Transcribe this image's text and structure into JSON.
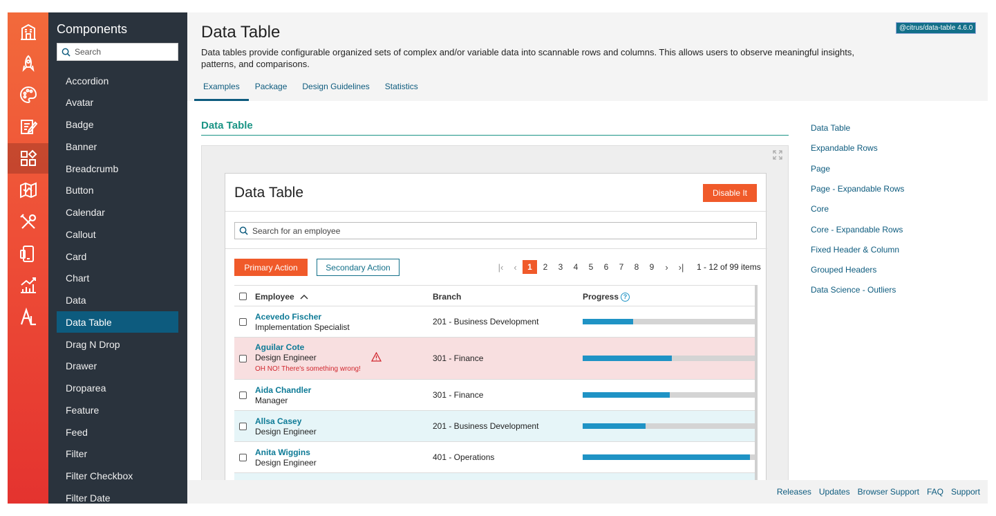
{
  "rail": {
    "items": [
      {
        "icon": "building-icon"
      },
      {
        "icon": "rocket-icon"
      },
      {
        "icon": "palette-icon"
      },
      {
        "icon": "edit-document-icon"
      },
      {
        "icon": "components-grid-icon",
        "active": true
      },
      {
        "icon": "map-icon"
      },
      {
        "icon": "tools-icon"
      },
      {
        "icon": "devices-icon"
      },
      {
        "icon": "chart-icon"
      },
      {
        "icon": "accessibility-icon"
      }
    ]
  },
  "sidebar": {
    "title": "Components",
    "search_placeholder": "Search",
    "items": [
      "Accordion",
      "Avatar",
      "Badge",
      "Banner",
      "Breadcrumb",
      "Button",
      "Calendar",
      "Callout",
      "Card",
      "Chart",
      "Data",
      "Data Table",
      "Drag N Drop",
      "Drawer",
      "Droparea",
      "Feature",
      "Feed",
      "Filter",
      "Filter Checkbox",
      "Filter Date"
    ],
    "active_item": "Data Table"
  },
  "header": {
    "title": "Data Table",
    "version_badge": "@citrus/data-table 4.6.0",
    "description": "Data tables provide configurable organized sets of complex and/or variable data into scannable rows and columns. This allows users to observe meaningful insights, patterns, and comparisons.",
    "tabs": [
      "Examples",
      "Package",
      "Design Guidelines",
      "Statistics"
    ],
    "active_tab": "Examples"
  },
  "section": {
    "title": "Data Table"
  },
  "right_nav": {
    "links": [
      "Data Table",
      "Expandable Rows",
      "Page",
      "Page - Expandable Rows",
      "Core",
      "Core - Expandable Rows",
      "Fixed Header & Column",
      "Grouped Headers",
      "Data Science - Outliers"
    ]
  },
  "demo": {
    "card_title": "Data Table",
    "disable_button": "Disable It",
    "search_placeholder": "Search for an employee",
    "primary_action": "Primary Action",
    "secondary_action": "Secondary Action",
    "pagination": {
      "pages": [
        "1",
        "2",
        "3",
        "4",
        "5",
        "6",
        "7",
        "8",
        "9"
      ],
      "current": "1",
      "info": "1 - 12 of 99 items"
    },
    "columns": {
      "employee": "Employee",
      "branch": "Branch",
      "progress": "Progress"
    },
    "rows": [
      {
        "name": "Acevedo Fischer",
        "title": "Implementation Specialist",
        "branch": "201 - Business Development",
        "progress": 0.29,
        "state": "normal"
      },
      {
        "name": "Aguilar Cote",
        "title": "Design Engineer",
        "branch": "301 - Finance",
        "progress": 0.51,
        "state": "error",
        "error": "OH NO! There's something wrong!"
      },
      {
        "name": "Aida Chandler",
        "title": "Manager",
        "branch": "301 - Finance",
        "progress": 0.5,
        "state": "normal"
      },
      {
        "name": "Allsa Casey",
        "title": "Design Engineer",
        "branch": "201 - Business Development",
        "progress": 0.36,
        "state": "highlight"
      },
      {
        "name": "Anita Wiggins",
        "title": "Design Engineer",
        "branch": "401 - Operations",
        "progress": 0.96,
        "state": "normal"
      }
    ]
  },
  "footer": {
    "links": [
      "Releases",
      "Updates",
      "Browser Support",
      "FAQ",
      "Support"
    ]
  }
}
